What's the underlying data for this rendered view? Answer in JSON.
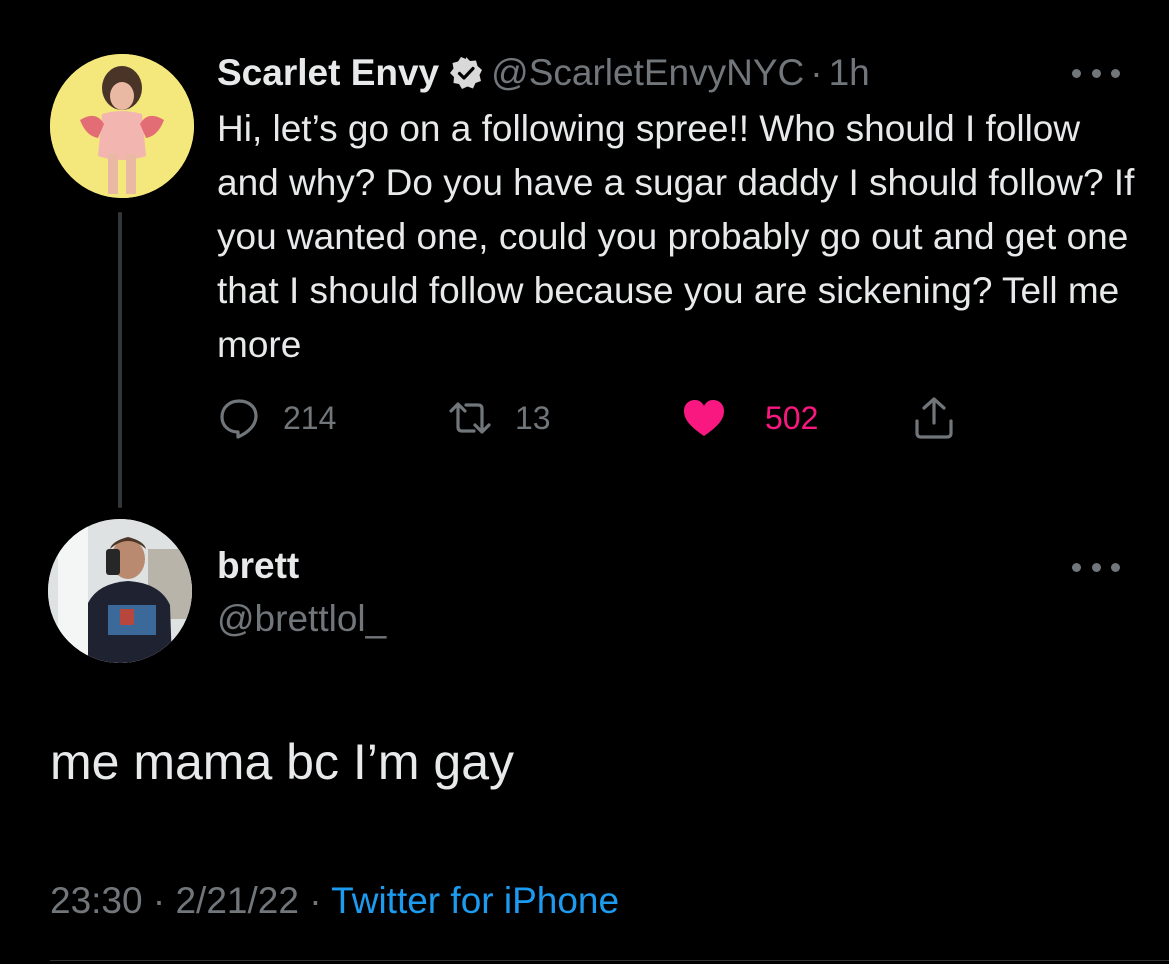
{
  "original_tweet": {
    "display_name": "Scarlet Envy",
    "handle": "@ScarletEnvyNYC",
    "separator": "·",
    "time_ago": "1h",
    "verified": true,
    "text": "Hi, let’s go on a following spree!! Who  should I follow and why? Do you have a sugar daddy I should follow? If you wanted one, could you probably go out and get one that I should follow because you are sickening? Tell me more",
    "stats": {
      "replies": "214",
      "retweets": "13",
      "likes": "502"
    }
  },
  "reply_tweet": {
    "display_name": "brett",
    "handle": "@brettlol_",
    "text": "me mama bc I’m gay",
    "time": "23:30",
    "separator": "·",
    "date": "2/21/22",
    "client": "Twitter for iPhone"
  },
  "icons": {
    "verified": "verified-badge-icon",
    "more": "more-horizontal-icon",
    "reply": "reply-bubble-icon",
    "retweet": "retweet-icon",
    "like": "heart-icon",
    "share": "share-upload-icon"
  },
  "colors": {
    "background": "#000000",
    "primary_text": "#e7e9ea",
    "secondary_text": "#71767b",
    "like_pink": "#f91880",
    "link_blue": "#1d9bf0",
    "thread_line": "#333639"
  }
}
